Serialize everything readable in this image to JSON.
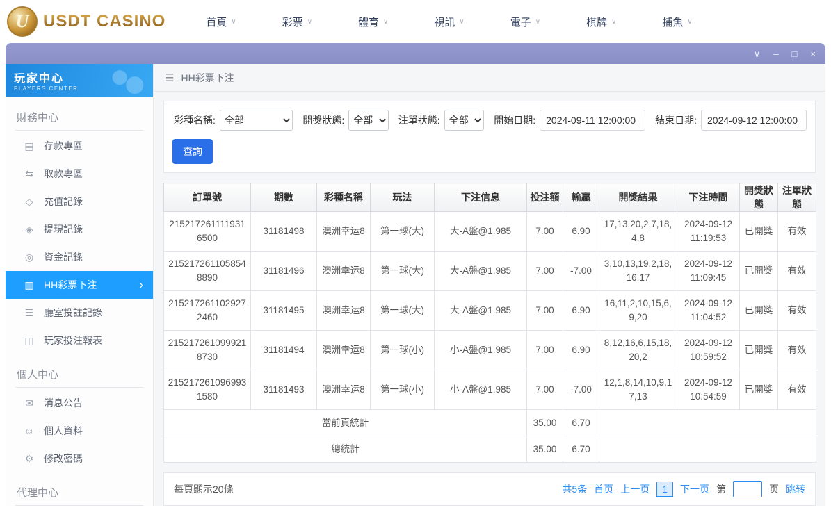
{
  "top_nav": {
    "logo_letter": "U",
    "logo_text": "USDT CASINO",
    "items": [
      {
        "label": "首頁"
      },
      {
        "label": "彩票"
      },
      {
        "label": "體育"
      },
      {
        "label": "視訊"
      },
      {
        "label": "電子"
      },
      {
        "label": "棋牌"
      },
      {
        "label": "捕魚"
      }
    ]
  },
  "window": {
    "controls": {
      "dropdown": "∨",
      "minimize": "–",
      "maximize": "□",
      "close": "×"
    }
  },
  "sidebar": {
    "title": "玩家中心",
    "subtitle": "PLAYERS CENTER",
    "sections": [
      {
        "header": "財務中心",
        "items": [
          {
            "label": "存款專區",
            "icon": "deposit-icon",
            "glyph": "▤",
            "active": false
          },
          {
            "label": "取款專區",
            "icon": "withdraw-icon",
            "glyph": "⇆",
            "active": false
          },
          {
            "label": "充值記錄",
            "icon": "recharge-record-icon",
            "glyph": "◇",
            "active": false
          },
          {
            "label": "提現記錄",
            "icon": "cashout-record-icon",
            "glyph": "◈",
            "active": false
          },
          {
            "label": "資金記錄",
            "icon": "funds-record-icon",
            "glyph": "◎",
            "active": false
          },
          {
            "label": "HH彩票下注",
            "icon": "lottery-bet-icon",
            "glyph": "▥",
            "active": true
          },
          {
            "label": "廳室投註記錄",
            "icon": "hall-bet-records-icon",
            "glyph": "☰",
            "active": false
          },
          {
            "label": "玩家投注報表",
            "icon": "player-report-icon",
            "glyph": "◫",
            "active": false
          }
        ]
      },
      {
        "header": "個人中心",
        "items": [
          {
            "label": "消息公告",
            "icon": "announcement-icon",
            "glyph": "✉",
            "active": false
          },
          {
            "label": "個人資料",
            "icon": "profile-icon",
            "glyph": "☺",
            "active": false
          },
          {
            "label": "修改密碼",
            "icon": "password-icon",
            "glyph": "⚙",
            "active": false
          }
        ]
      },
      {
        "header": "代理中心",
        "items": []
      }
    ]
  },
  "main": {
    "breadcrumb": {
      "menu_icon": "☰",
      "title": "HH彩票下注"
    },
    "filters": {
      "lottery_label": "彩種名稱:",
      "lottery_value": "全部",
      "draw_status_label": "開獎狀態:",
      "draw_status_value": "全部",
      "order_status_label": "注單狀態:",
      "order_status_value": "全部",
      "start_label": "開始日期:",
      "start_value": "2024-09-11 12:00:00",
      "end_label": "結束日期:",
      "end_value": "2024-09-12 12:00:00",
      "search_button": "查詢"
    },
    "table": {
      "headers": [
        "訂單號",
        "期數",
        "彩種名稱",
        "玩法",
        "下注信息",
        "投注額",
        "輸贏",
        "開獎結果",
        "下注時間",
        "開獎狀態",
        "注單狀態"
      ],
      "rows": [
        {
          "order_no": "2152172611119316500",
          "issue": "31181498",
          "lottery": "澳洲幸运8",
          "play": "第一球(大)",
          "bet_info": "大-A盤@1.985",
          "amount": "7.00",
          "win": "6.90",
          "result": "17,13,20,2,7,18,4,8",
          "time": "2024-09-12 11:19:53",
          "draw_status": "已開獎",
          "order_status": "有效"
        },
        {
          "order_no": "2152172611058548890",
          "issue": "31181496",
          "lottery": "澳洲幸运8",
          "play": "第一球(大)",
          "bet_info": "大-A盤@1.985",
          "amount": "7.00",
          "win": "-7.00",
          "result": "3,10,13,19,2,18,16,17",
          "time": "2024-09-12 11:09:45",
          "draw_status": "已開獎",
          "order_status": "有效"
        },
        {
          "order_no": "2152172611029272460",
          "issue": "31181495",
          "lottery": "澳洲幸运8",
          "play": "第一球(大)",
          "bet_info": "大-A盤@1.985",
          "amount": "7.00",
          "win": "6.90",
          "result": "16,11,2,10,15,6,9,20",
          "time": "2024-09-12 11:04:52",
          "draw_status": "已開獎",
          "order_status": "有效"
        },
        {
          "order_no": "2152172610999218730",
          "issue": "31181494",
          "lottery": "澳洲幸运8",
          "play": "第一球(小)",
          "bet_info": "小-A盤@1.985",
          "amount": "7.00",
          "win": "6.90",
          "result": "8,12,16,6,15,18,20,2",
          "time": "2024-09-12 10:59:52",
          "draw_status": "已開獎",
          "order_status": "有效"
        },
        {
          "order_no": "2152172610969931580",
          "issue": "31181493",
          "lottery": "澳洲幸运8",
          "play": "第一球(小)",
          "bet_info": "小-A盤@1.985",
          "amount": "7.00",
          "win": "-7.00",
          "result": "12,1,8,14,10,9,17,13",
          "time": "2024-09-12 10:54:59",
          "draw_status": "已開獎",
          "order_status": "有效"
        }
      ],
      "summaries": [
        {
          "label": "當前頁統計",
          "amount": "35.00",
          "win": "6.70"
        },
        {
          "label": "總統計",
          "amount": "35.00",
          "win": "6.70"
        }
      ]
    },
    "pagination": {
      "page_size_text": "每頁顯示20條",
      "total_text": "共5条",
      "first": "首页",
      "prev": "上一页",
      "current": "1",
      "next": "下一页",
      "jump_pre": "第",
      "jump_post": "页",
      "jump": "跳转"
    }
  }
}
